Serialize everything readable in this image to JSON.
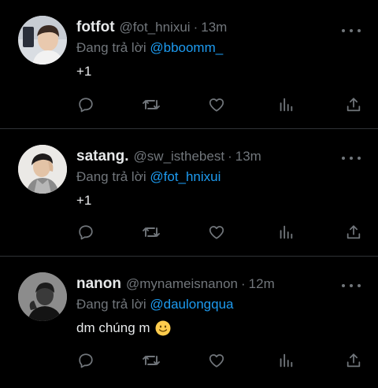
{
  "tweets": [
    {
      "name": "fotfot",
      "handle": "@fot_hnixui",
      "separator": "·",
      "time": "13m",
      "reply_prefix": "Đang trả lời",
      "reply_to": "@bboomm_",
      "text": "+1",
      "emoji": ""
    },
    {
      "name": "satang.",
      "handle": "@sw_isthebest",
      "separator": "·",
      "time": "13m",
      "reply_prefix": "Đang trả lời",
      "reply_to": "@fot_hnixui",
      "text": "+1",
      "emoji": ""
    },
    {
      "name": "nanon",
      "handle": "@mynameisnanon",
      "separator": "·",
      "time": "12m",
      "reply_prefix": "Đang trả lời",
      "reply_to": "@daulongqua",
      "text": "dm chúng m",
      "emoji": "slightly-smiling-face"
    }
  ],
  "actions": [
    "reply-icon",
    "retweet-icon",
    "like-icon",
    "stats-icon",
    "share-icon"
  ],
  "colors": {
    "background": "#000000",
    "text_primary": "#e7e9ea",
    "text_secondary": "#71767b",
    "link": "#1d9bf0",
    "divider": "#2f3336",
    "emoji": "#ffcc4d"
  }
}
